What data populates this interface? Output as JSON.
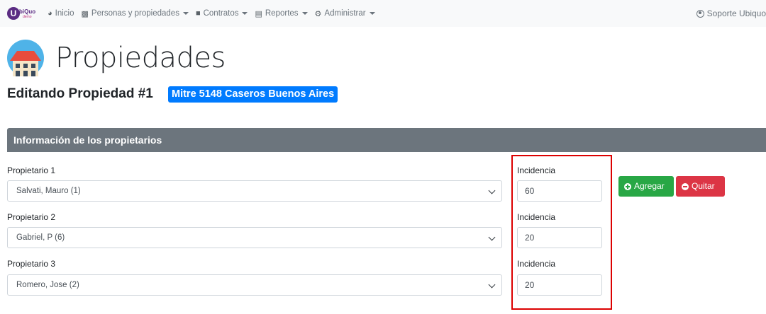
{
  "navbar": {
    "brand": {
      "letter": "U",
      "name": "biQuo",
      "sub": "demo"
    },
    "items": [
      {
        "label": "Inicio",
        "icon": "tachometer-icon",
        "dropdown": false
      },
      {
        "label": "Personas y propiedades",
        "icon": "address-card-icon",
        "dropdown": true
      },
      {
        "label": "Contratos",
        "icon": "square-icon",
        "dropdown": true
      },
      {
        "label": "Reportes",
        "icon": "file-icon",
        "dropdown": true
      },
      {
        "label": "Administrar",
        "icon": "gear-icon",
        "dropdown": true
      }
    ],
    "user": {
      "label": "Soporte Ubiquo",
      "icon": "user-circle-icon"
    }
  },
  "header": {
    "title": "Propiedades",
    "editing_label": "Editando Propiedad #1",
    "address_badge": "Mitre 5148 Caseros Buenos Aires"
  },
  "section": {
    "title": "Información de los propietarios"
  },
  "owners": [
    {
      "label": "Propietario 1",
      "selected": "Salvati, Mauro (1)",
      "incidence_label": "Incidencia",
      "incidence_value": "60"
    },
    {
      "label": "Propietario 2",
      "selected": "Gabriel, P (6)",
      "incidence_label": "Incidencia",
      "incidence_value": "20"
    },
    {
      "label": "Propietario 3",
      "selected": "Romero, Jose (2)",
      "incidence_label": "Incidencia",
      "incidence_value": "20"
    }
  ],
  "actions": {
    "add_label": "Agregar",
    "remove_label": "Quitar"
  },
  "colors": {
    "primary": "#007bff",
    "secondary": "#6c757d",
    "success": "#28a745",
    "danger": "#dc3545",
    "highlight": "#dc0000",
    "brand": "#5b2c83"
  }
}
